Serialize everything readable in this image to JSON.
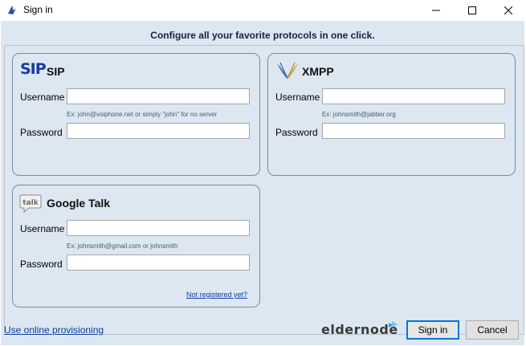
{
  "window": {
    "title": "Sign in",
    "app_icon": "jitsi-app-icon",
    "minimize_icon": "minimize-icon",
    "maximize_icon": "maximize-icon",
    "close_icon": "close-icon"
  },
  "header": {
    "text": "Configure all your favorite protocols in one click."
  },
  "sip": {
    "logo_text": "SIP",
    "title": "SIP",
    "username_label": "Username",
    "username_value": "",
    "username_hint": "Ex: john@voiphone.net or simply \"john\" for no server",
    "password_label": "Password",
    "password_value": ""
  },
  "xmpp": {
    "logo": "xmpp-logo-icon",
    "title": "XMPP",
    "username_label": "Username",
    "username_value": "",
    "username_hint": "Ex: johnsmith@jabber.org",
    "password_label": "Password",
    "password_value": ""
  },
  "gtalk": {
    "logo_text": "talk",
    "title": "Google Talk",
    "username_label": "Username",
    "username_value": "",
    "username_hint": "Ex: johnsmith@gmail.com or johnsmith",
    "password_label": "Password",
    "password_value": "",
    "register_link": "Not registered yet?"
  },
  "footer": {
    "provisioning_link": "Use online provisioning",
    "brand_text": "eldernode",
    "signin_label": "Sign in",
    "cancel_label": "Cancel"
  },
  "colors": {
    "client_bg": "#dce7f1",
    "link": "#0b3d9e",
    "sip_logo": "#1a3aa8",
    "accent_focus": "#0078d7"
  }
}
